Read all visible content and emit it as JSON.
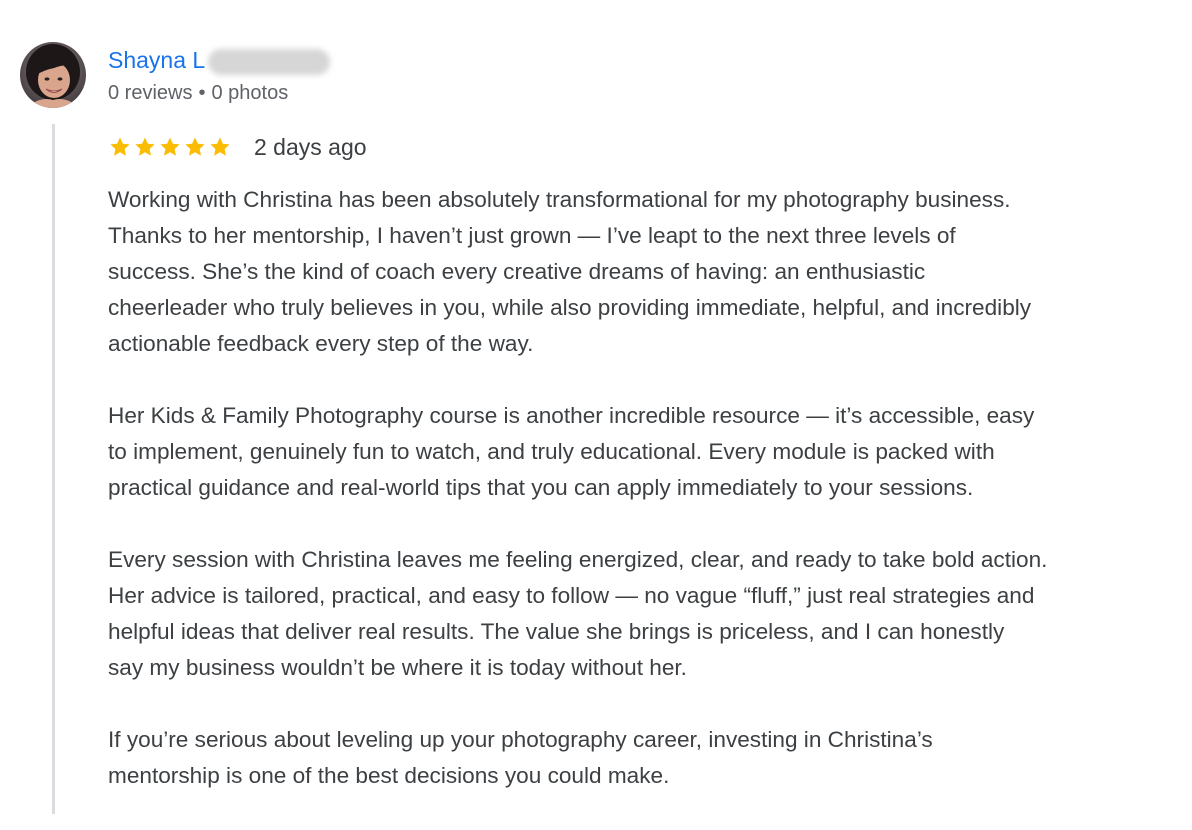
{
  "reviewer": {
    "name": "Shayna L",
    "review_count": "0 reviews",
    "separator": "•",
    "photo_count": "0 photos"
  },
  "review": {
    "rating": 5,
    "max_rating": 5,
    "date": "2 days ago",
    "paragraphs": [
      {
        "lines": [
          "Working with Christina has been absolutely transformational for my photography business.",
          "Thanks to her mentorship, I haven’t just grown — I’ve leapt to the next three levels of",
          "success. She’s the kind of coach every creative dreams of having: an enthusiastic",
          "cheerleader who truly believes in you, while also providing immediate, helpful, and incredibly",
          "actionable feedback every step of the way."
        ]
      },
      {
        "lines": [
          "Her Kids & Family Photography course is another incredible resource — it’s accessible, easy",
          "to implement, genuinely fun to watch, and truly educational. Every module is packed with",
          "practical guidance and real-world tips that you can apply immediately to your sessions."
        ]
      },
      {
        "lines": [
          "Every session with Christina leaves me feeling energized, clear, and ready to take bold action.",
          "Her advice is tailored, practical, and easy to follow — no vague “fluff,” just real strategies and",
          "helpful ideas that deliver real results. The value she brings is priceless, and I can honestly",
          "say my business wouldn’t be where it is today without her."
        ]
      },
      {
        "lines": [
          "If you’re serious about leveling up your photography career, investing in Christina’s",
          "mentorship is one of the best decisions you could make."
        ]
      }
    ]
  },
  "icons": {
    "star": "star-icon",
    "avatar": "profile-photo"
  },
  "colors": {
    "name_link": "#1a73e8",
    "meta_text": "#5f6368",
    "body_text": "#3c4043",
    "star_fill": "#fbbc04",
    "thread_line": "#dadce0"
  }
}
